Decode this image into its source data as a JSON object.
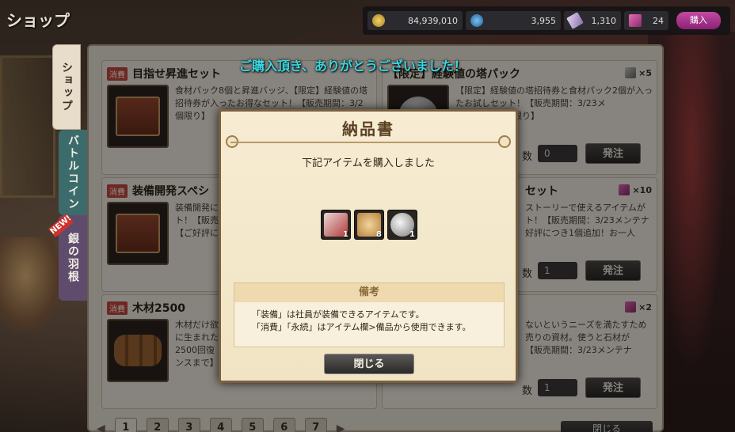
{
  "header": {
    "title": "ショップ",
    "currencies": [
      {
        "icon": "coin-icon",
        "value": "84,939,010"
      },
      {
        "icon": "gem-icon",
        "value": "3,955"
      },
      {
        "icon": "feather-icon",
        "value": "1,310"
      },
      {
        "icon": "ticket-icon",
        "value": "24"
      }
    ],
    "buy_label": "購入"
  },
  "tabs": [
    {
      "label": "ショップ"
    },
    {
      "label": "バトルコイン"
    },
    {
      "label": "銀の羽根"
    }
  ],
  "new_badge": "NEW!",
  "items": [
    {
      "tag": "消費",
      "name": "目指せ昇進セット",
      "desc": "食材パック8個と昇進バッジ、【限定】経験値の塔招待券が入ったお得なセット！【販売期間：3/2",
      "desc2": "個限り】"
    },
    {
      "tag": "",
      "name": "【限定】経験値の塔パック",
      "desc": "【限定】経験値の塔招待券と食材パック2個が入ったお試しセット！【販売期間：3/23メ",
      "desc2": "【お一人様1個限り】",
      "mult": "×5",
      "qty_label": "数",
      "qty": "0",
      "order": "発注"
    },
    {
      "tag": "消費",
      "name": "装備開発スペシ",
      "desc": "装備開発に",
      "desc2": "ト！【販売",
      "desc3": "【ご好評に"
    },
    {
      "tag": "",
      "name": "セット",
      "desc": "ストーリーで使えるアイテムが",
      "desc2": "ト！【販売期間：3/23メンテナ",
      "desc3": "好評につき1個追加！お一人",
      "mult": "×10",
      "qty_label": "数",
      "qty": "1",
      "order": "発注"
    },
    {
      "tag": "消費",
      "name": "木材2500",
      "desc": "木材だけ欲",
      "desc2": "に生まれた",
      "desc3": "2500回復",
      "desc4": "ンスまで】"
    },
    {
      "tag": "",
      "name": "",
      "desc": "ないというニーズを満たすため",
      "desc2": "売りの資材。使うと石材が",
      "desc3": "【販売期間：3/23メンテナ",
      "mult": "×2",
      "qty_label": "数",
      "qty": "1",
      "order": "発注"
    }
  ],
  "pager": {
    "pages": [
      "1",
      "2",
      "3",
      "4",
      "5",
      "6",
      "7"
    ],
    "close_label": "閉じる"
  },
  "modal": {
    "banner": "ご購入頂き、ありがとうございました！",
    "title": "納品書",
    "message": "下記アイテムを購入しました",
    "items": [
      {
        "icon": "ticket-item-icon",
        "count": "1"
      },
      {
        "icon": "food-pack-icon",
        "count": "8"
      },
      {
        "icon": "silver-badge-icon",
        "count": "1"
      }
    ],
    "remarks_title": "備考",
    "remarks_line1": "「装備」は社員が装備できるアイテムです。",
    "remarks_line2": "「消費」「永続」はアイテム欄>備品から使用できます。",
    "close_label": "閉じる"
  }
}
